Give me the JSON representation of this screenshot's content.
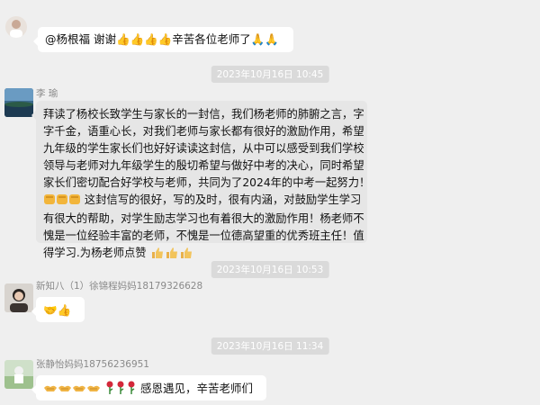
{
  "messages": [
    {
      "sender": "",
      "text": "@杨根福  谢谢👍👍👍👍辛苦各位老师了🙏🙏"
    },
    {
      "timestamp": "2023年10月16日 10:45",
      "sender": "李  瑜",
      "lines": [
        "拜读了杨校长致学生与家长的一封信，我们杨老师的肺腑之言，字",
        "字千金，语重心长，对我们老师与家长都有很好的激励作用，希望",
        "九年级的学生家长们也好好读读这封信，从中可以感受到我们学校",
        "领导与老师对九年级学生的殷切希望与做好中考的决心，同时希望",
        "家长们密切配合好学校与老师，共同为了2024年的中考一起努力！",
        "这封信写的很好，写的及时，很有内涵，对鼓励学生学习",
        "有很大的帮助，对学生励志学习也有着很大的激励作用！杨老师不",
        "愧是一位经验丰富的老师，不愧是一位德高望重的优秀班主任！值",
        "得学习.为杨老师点赞"
      ]
    },
    {
      "timestamp": "2023年10月16日 10:53",
      "sender": "新知八（1）徐锦程妈妈18179326628",
      "text": "🤝👍"
    },
    {
      "timestamp": "2023年10月16日 11:34",
      "sender": "张静怡妈妈18756236951",
      "text_suffix": "感恩遇见，辛苦老师们"
    }
  ],
  "colors": {
    "background": "#efefef",
    "bubble_white": "#ffffff",
    "bubble_gray": "#e6e6e6",
    "timestamp_bg": "#dadada",
    "thumb": "#e8b04a"
  },
  "icons": [
    "thumbs-up-icon",
    "pray-icon",
    "handshake-icon",
    "rose-icon",
    "fist-icon"
  ]
}
